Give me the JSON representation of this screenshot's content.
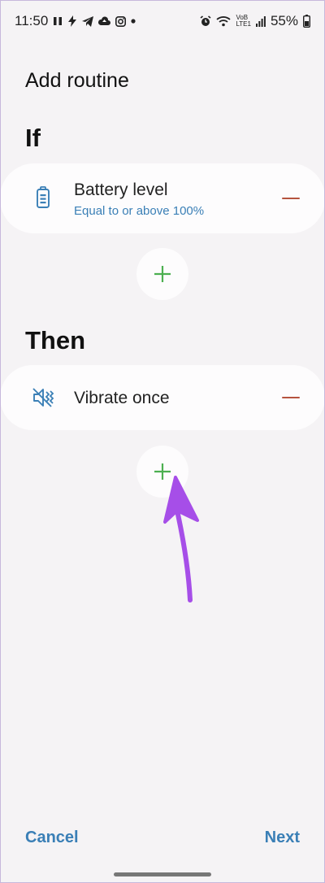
{
  "status_bar": {
    "time": "11:50",
    "battery_percent": "55%",
    "network_label_line1": "VoB",
    "network_label_line2": "LTE1",
    "left_icons": [
      "pause-icon",
      "bolt-icon",
      "telegram-icon",
      "cloud-upload-icon",
      "instagram-icon",
      "dot-icon"
    ],
    "right_icons": [
      "alarm-icon",
      "wifi-icon",
      "signal-icon",
      "battery-icon"
    ]
  },
  "header": {
    "title": "Add routine"
  },
  "if_section": {
    "title": "If",
    "condition": {
      "title": "Battery level",
      "subtitle": "Equal to or above 100%",
      "icon": "battery-icon"
    }
  },
  "then_section": {
    "title": "Then",
    "action": {
      "title": "Vibrate once",
      "icon": "vibrate-icon"
    }
  },
  "footer": {
    "cancel_label": "Cancel",
    "next_label": "Next"
  },
  "colors": {
    "accent_blue": "#3a7fb6",
    "remove_red": "#b5533e",
    "add_green": "#4caf50",
    "annotation_purple": "#a64ee8"
  }
}
